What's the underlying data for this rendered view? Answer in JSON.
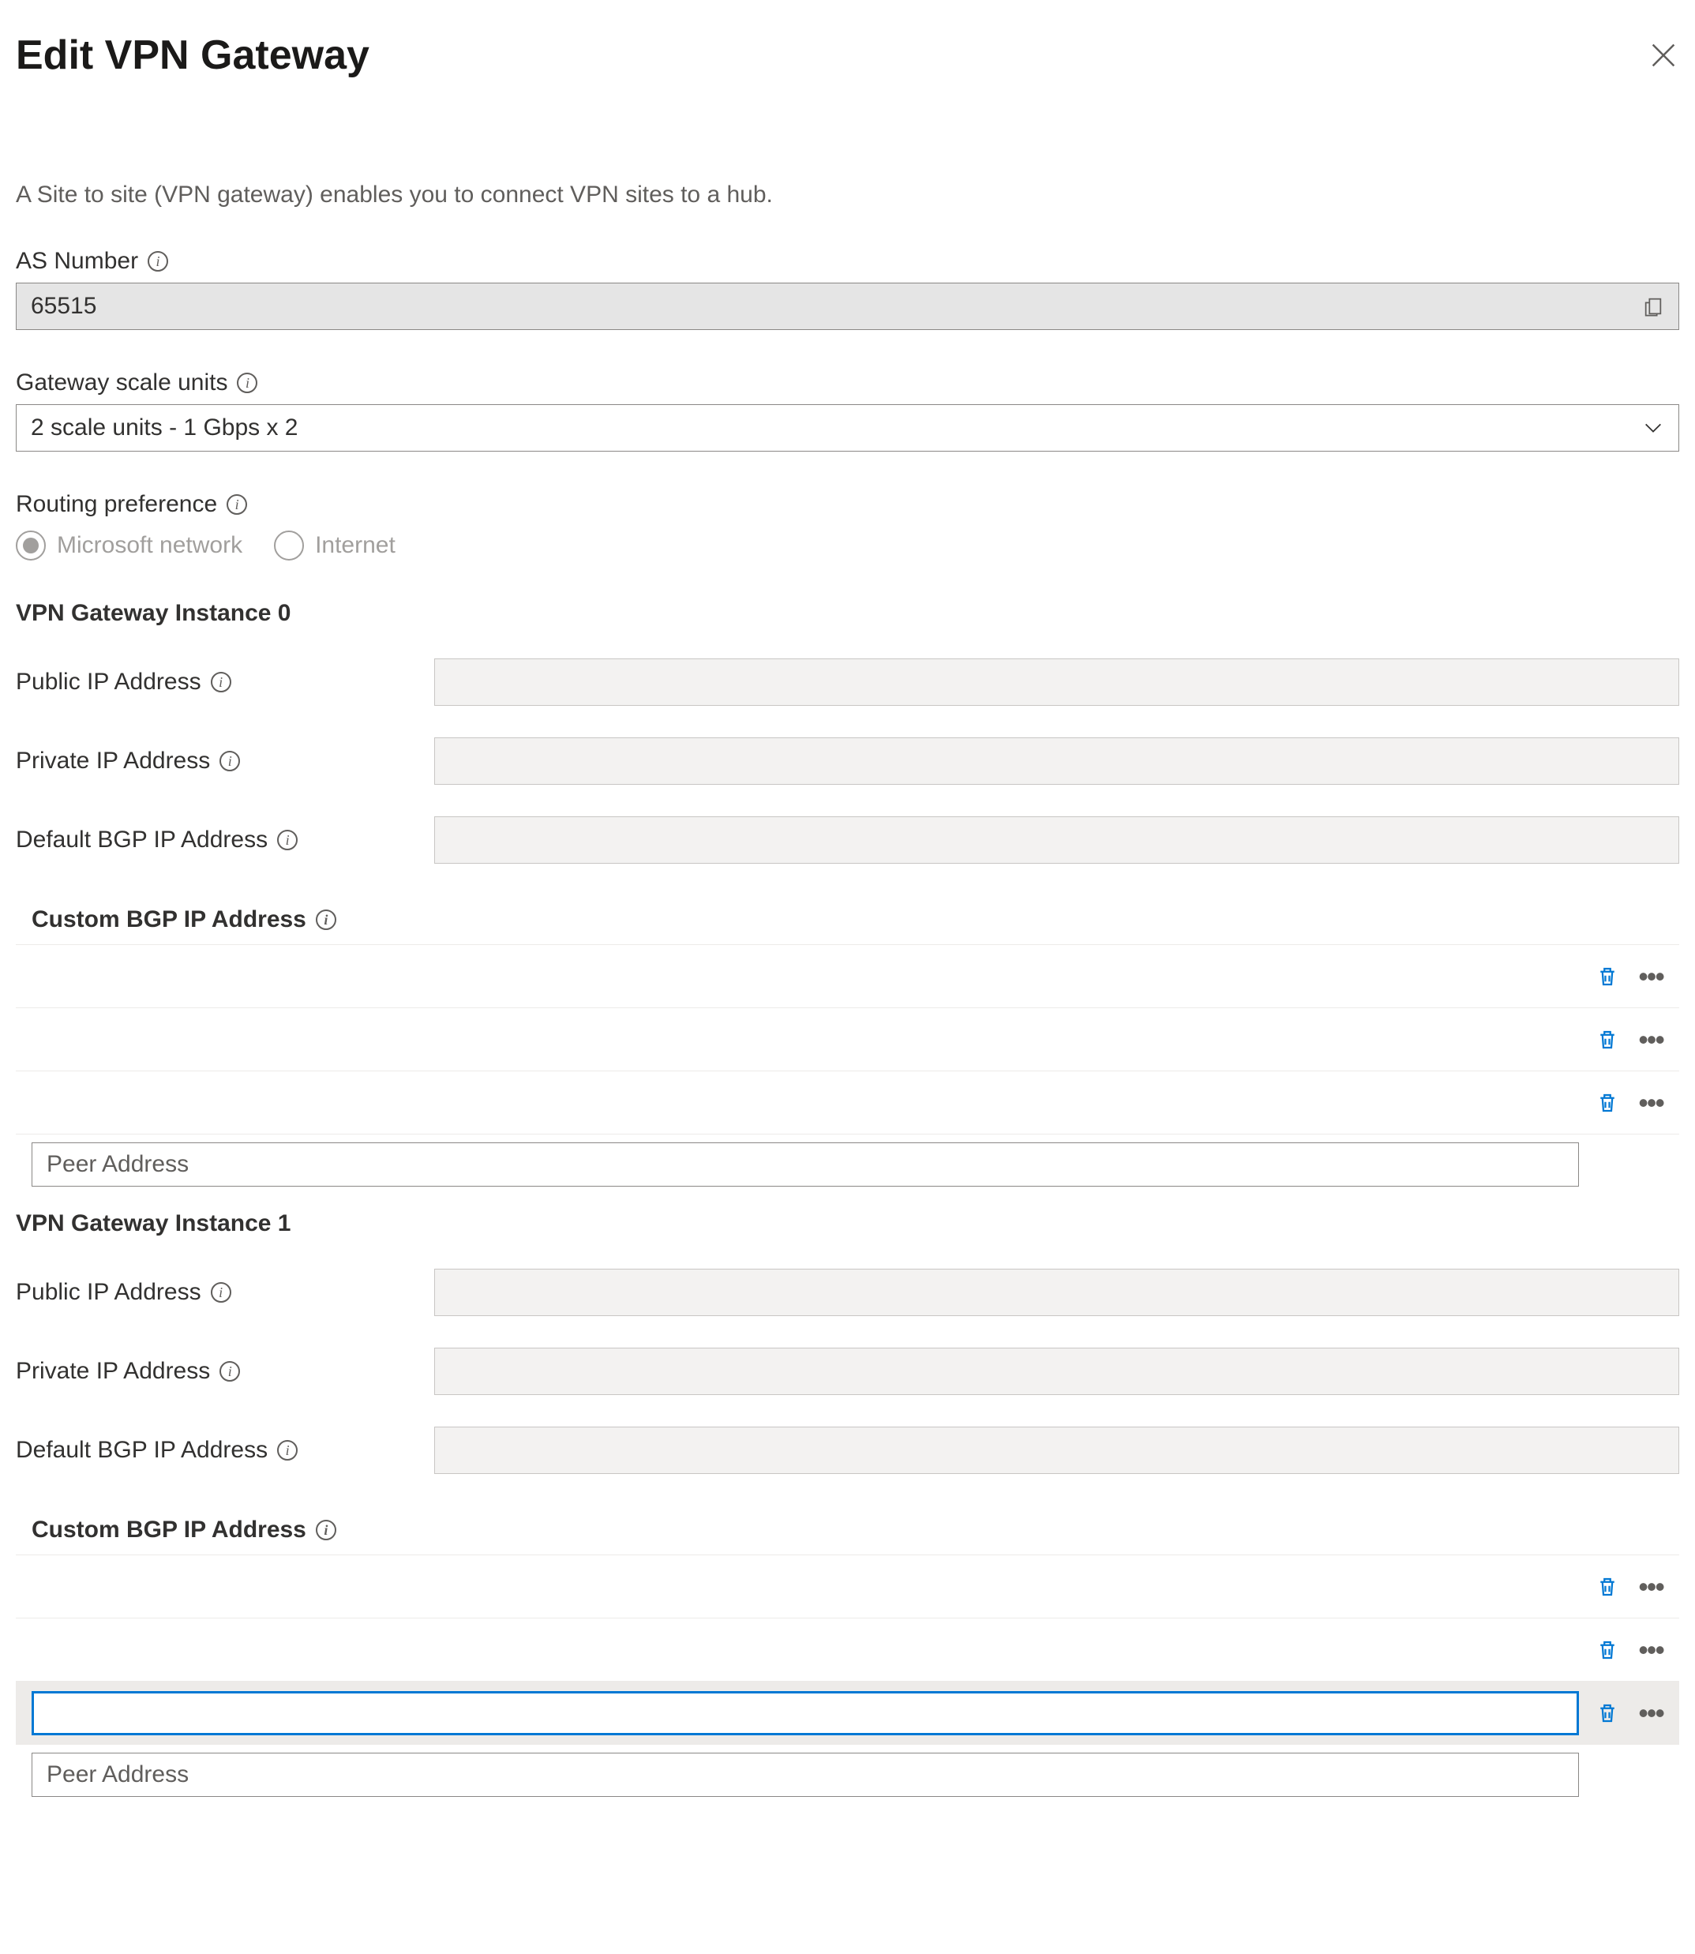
{
  "header": {
    "title": "Edit VPN Gateway"
  },
  "description": "A Site to site (VPN gateway) enables you to connect VPN sites to a hub.",
  "as_number": {
    "label": "AS Number",
    "value": "65515"
  },
  "scale_units": {
    "label": "Gateway scale units",
    "value": "2 scale units - 1 Gbps x 2"
  },
  "routing_pref": {
    "label": "Routing preference",
    "options": {
      "ms": "Microsoft network",
      "internet": "Internet"
    },
    "selected": "ms"
  },
  "instances": [
    {
      "heading": "VPN Gateway Instance 0",
      "public_ip_label": "Public IP Address",
      "private_ip_label": "Private IP Address",
      "default_bgp_label": "Default BGP IP Address",
      "custom_bgp_label": "Custom BGP IP Address",
      "peer_placeholder": "Peer Address"
    },
    {
      "heading": "VPN Gateway Instance 1",
      "public_ip_label": "Public IP Address",
      "private_ip_label": "Private IP Address",
      "default_bgp_label": "Default BGP IP Address",
      "custom_bgp_label": "Custom BGP IP Address",
      "peer_placeholder": "Peer Address"
    }
  ]
}
